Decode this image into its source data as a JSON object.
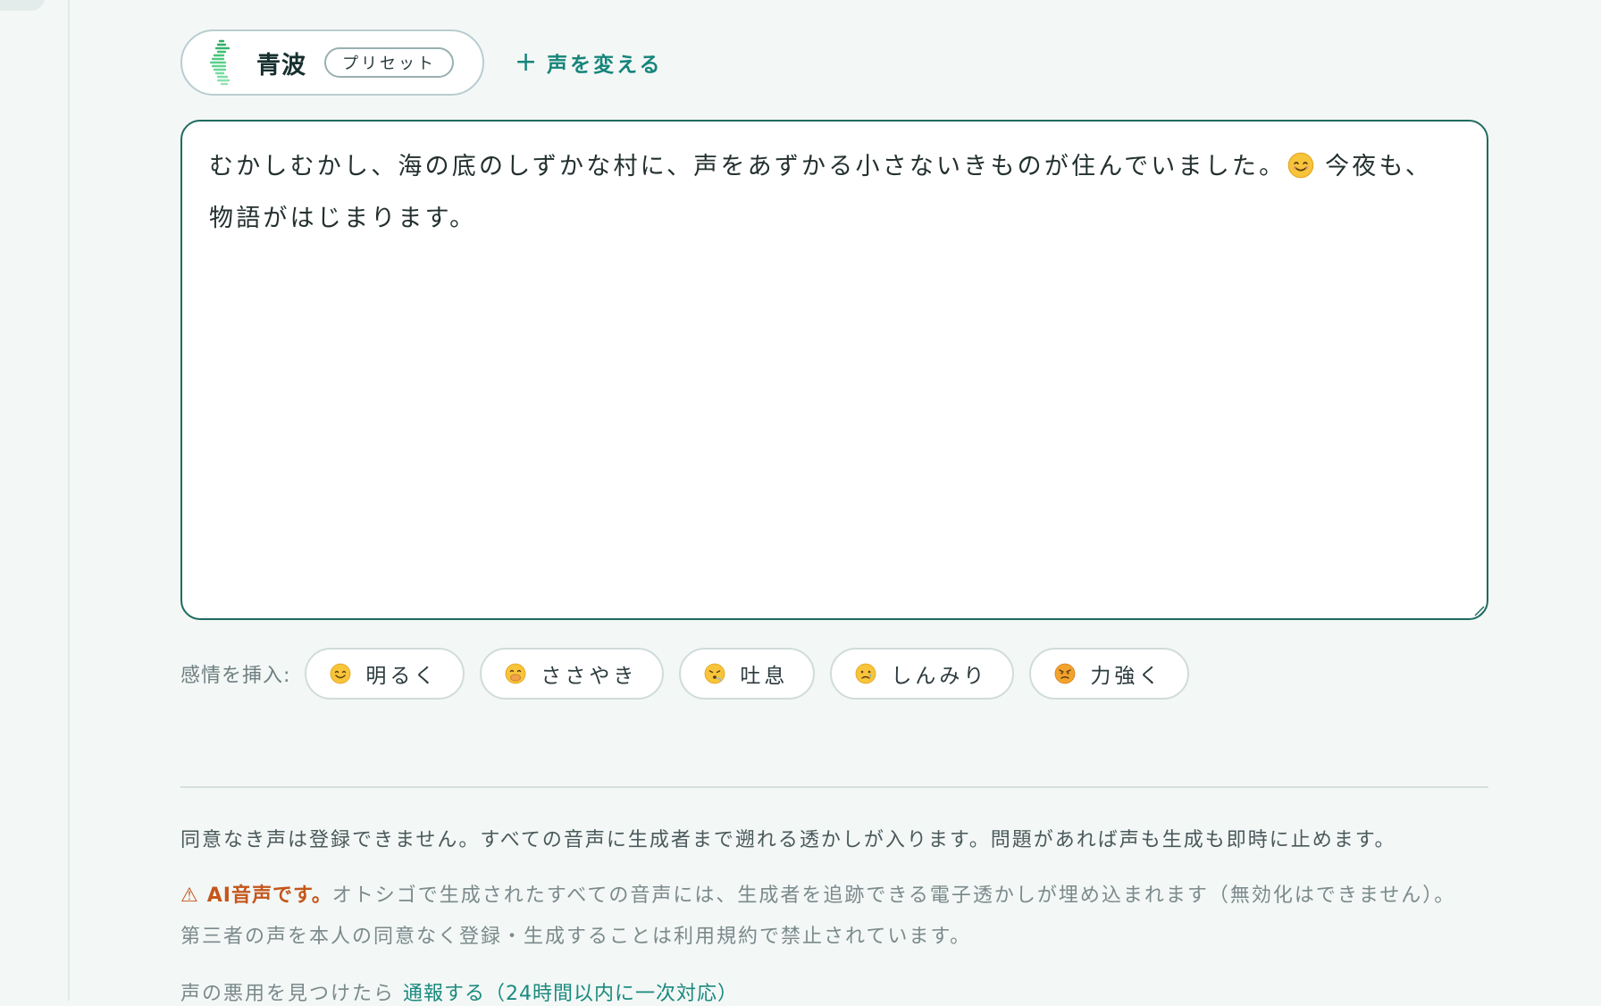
{
  "voice": {
    "name": "青波",
    "badge": "プリセット",
    "change_label": "声を変える",
    "change_icon": "plus-icon",
    "avatar_icon": "seahorse-icon"
  },
  "editor": {
    "text_line1": "むかしむかし、海の底のしずかな村に、声をあずかる小さないきものが住んでいました。",
    "emoji": "smiling-face-icon",
    "text_line1_tail": " 今夜も、",
    "text_line2": "物語がはじまります。"
  },
  "emotions": {
    "label": "感情を挿入:",
    "items": [
      {
        "label": "明るく",
        "icon": "smiling-face-icon"
      },
      {
        "label": "ささやき",
        "icon": "face-with-hand-over-mouth-icon"
      },
      {
        "label": "吐息",
        "icon": "face-exhaling-icon"
      },
      {
        "label": "しんみり",
        "icon": "crying-face-icon"
      },
      {
        "label": "力強く",
        "icon": "angry-face-icon"
      }
    ]
  },
  "notices": {
    "consent": "同意なき声は登録できません。すべての音声に生成者まで遡れる透かしが入ります。問題があれば声も生成も即時に止めます。",
    "ai_warning_icon": "⚠",
    "ai_warning_label": "AI音声です。",
    "ai_warning_text1": "オトシゴで生成されたすべての音声には、生成者を追跡できる電子透かしが埋め込まれます（無効化はできません）。",
    "ai_warning_text2": "第三者の声を本人の同意なく登録・生成することは利用規約で禁止されています。",
    "abuse_prefix": "声の悪用を見つけたら",
    "report_link": "通報する（24時間以内に一次対応）"
  },
  "colors": {
    "accent": "#15857a",
    "editor_border": "#1f6a5f",
    "warning": "#c5561a",
    "background": "#f3f7f6"
  }
}
